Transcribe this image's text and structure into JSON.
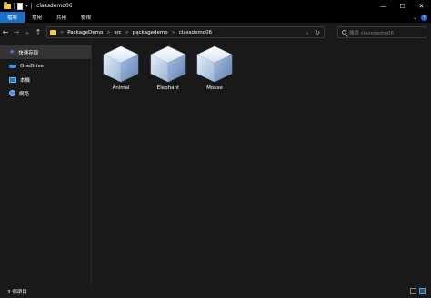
{
  "window": {
    "title": "classdemo06",
    "controls": {
      "minimize": "—",
      "maximize": "☐",
      "close": "✕"
    }
  },
  "ribbon": {
    "tabs": [
      {
        "label": "檔案",
        "active": true
      },
      {
        "label": "常用",
        "active": false
      },
      {
        "label": "共用",
        "active": false
      },
      {
        "label": "檢視",
        "active": false
      }
    ],
    "help": "?"
  },
  "address": {
    "breadcrumb": [
      "PackageDemo",
      "src",
      "packagedemo",
      "classdemo06"
    ],
    "separator": ">"
  },
  "search": {
    "placeholder": "搜尋 classdemo06"
  },
  "sidebar": {
    "items": [
      {
        "label": "快速存取",
        "icon": "star-icon"
      },
      {
        "label": "OneDrive",
        "icon": "cloud-icon"
      },
      {
        "label": "本機",
        "icon": "computer-icon"
      },
      {
        "label": "網路",
        "icon": "network-icon"
      }
    ]
  },
  "files": [
    {
      "name": "Animal",
      "icon": "netbeans-class-cube-icon"
    },
    {
      "name": "Elephant",
      "icon": "netbeans-class-cube-icon"
    },
    {
      "name": "Mouse",
      "icon": "netbeans-class-cube-icon"
    }
  ],
  "status": {
    "item_count": "3 個項目"
  },
  "colors": {
    "accent": "#1a6fc9",
    "background": "#191919",
    "titlebar": "#000000"
  }
}
